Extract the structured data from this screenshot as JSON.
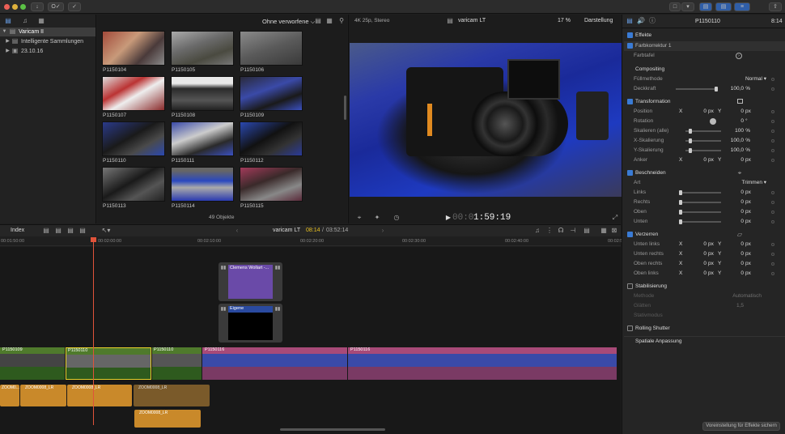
{
  "toolbar": {
    "key_label": "O✓",
    "window_buttons": [
      "close",
      "minimize",
      "zoom"
    ]
  },
  "library": {
    "items": [
      {
        "label": "Varicam II"
      },
      {
        "label": "Intelligente Sammlungen"
      },
      {
        "label": "23.10.16"
      }
    ]
  },
  "browser": {
    "filter": "Ohne verworfene ⌵",
    "count": "49 Objekte",
    "clips": [
      {
        "name": "P1150104"
      },
      {
        "name": "P1150105"
      },
      {
        "name": "P1150106"
      },
      {
        "name": "P1150107"
      },
      {
        "name": "P1150108"
      },
      {
        "name": "P1150109"
      },
      {
        "name": "P1150110"
      },
      {
        "name": "P1150111"
      },
      {
        "name": "P1150112"
      },
      {
        "name": "P1150113"
      },
      {
        "name": "P1150114"
      },
      {
        "name": "P1150115"
      }
    ]
  },
  "viewer": {
    "format": "4K 25p, Stereo",
    "title": "varicam LT",
    "zoom": "17 %",
    "view_menu": "Darstellung",
    "timecode_dim": "00:0",
    "timecode": "1:59:19"
  },
  "timeline": {
    "index_label": "Index",
    "project": "varicam LT",
    "position": "08:14",
    "duration": "03:52:14",
    "ruler": [
      "00:01:50:00",
      "00:02:00:00",
      "00:02:10:00",
      "00:02:20:00",
      "00:02:30:00",
      "00:02:40:00",
      "00:02:5"
    ],
    "title_clip": "Clemens Wollart -...",
    "generator_clip": "Eigene",
    "clips": [
      {
        "name": "P1150109"
      },
      {
        "name": "P1150110"
      },
      {
        "name": "P1150110"
      },
      {
        "name": "P1150116"
      },
      {
        "name": "P1150116"
      }
    ],
    "audio": [
      {
        "name": "ZOOM0..."
      },
      {
        "name": "ZOOM0008_LR"
      },
      {
        "name": "ZOOM0008_LR"
      },
      {
        "name": "ZOOM0008_LR"
      },
      {
        "name": "ZOOM0008_LR"
      }
    ]
  },
  "inspector": {
    "clip": "P1150110",
    "duration": "8:14",
    "effekte": "Effekte",
    "farbkorrektur": "Farbkorrektur 1",
    "farbtafel": "Farbtafel",
    "compositing": "Compositing",
    "fullmethode_k": "Füllmethode",
    "fullmethode_v": "Normal ▾",
    "deckkraft_k": "Deckkraft",
    "deckkraft_v": "100,0",
    "pct": "%",
    "transformation": "Transformation",
    "position_k": "Position",
    "x": "X",
    "y": "Y",
    "px": "px",
    "zero": "0",
    "rotation_k": "Rotation",
    "rotation_v": "0",
    "deg": "°",
    "skal_alle_k": "Skalieren (alle)",
    "skal_alle_v": "100",
    "xskal_k": "X-Skalierung",
    "xskal_v": "100,0",
    "yskal_k": "Y-Skalierung",
    "yskal_v": "100,0",
    "anker_k": "Anker",
    "beschneiden": "Beschneiden",
    "art_k": "Art",
    "art_v": "Trimmen ▾",
    "links_k": "Links",
    "rechts_k": "Rechts",
    "oben_k": "Oben",
    "unten_k": "Unten",
    "verzerren": "Verzerren",
    "ul_k": "Unten links",
    "ur_k": "Unten rechts",
    "or_k": "Oben rechts",
    "ol_k": "Oben links",
    "stabilisierung": "Stabilisierung",
    "methode_k": "Methode",
    "methode_v": "Automatisch",
    "glatten_k": "Glätten",
    "glatten_v": "1,5",
    "stativ_k": "Stativmodus",
    "rolling": "Rolling Shutter",
    "spatial": "Spatiale Anpassung",
    "save_preset": "Voreinstellung für Effekte sichern"
  },
  "colors": {
    "accent": "#3a7bd5",
    "playhead": "#e0533a",
    "video_green": "#4f7a2c",
    "video_pink": "#a84a78",
    "audio": "#c9892a",
    "title_purple": "#6a4aa8",
    "selection": "#e8d22a"
  }
}
